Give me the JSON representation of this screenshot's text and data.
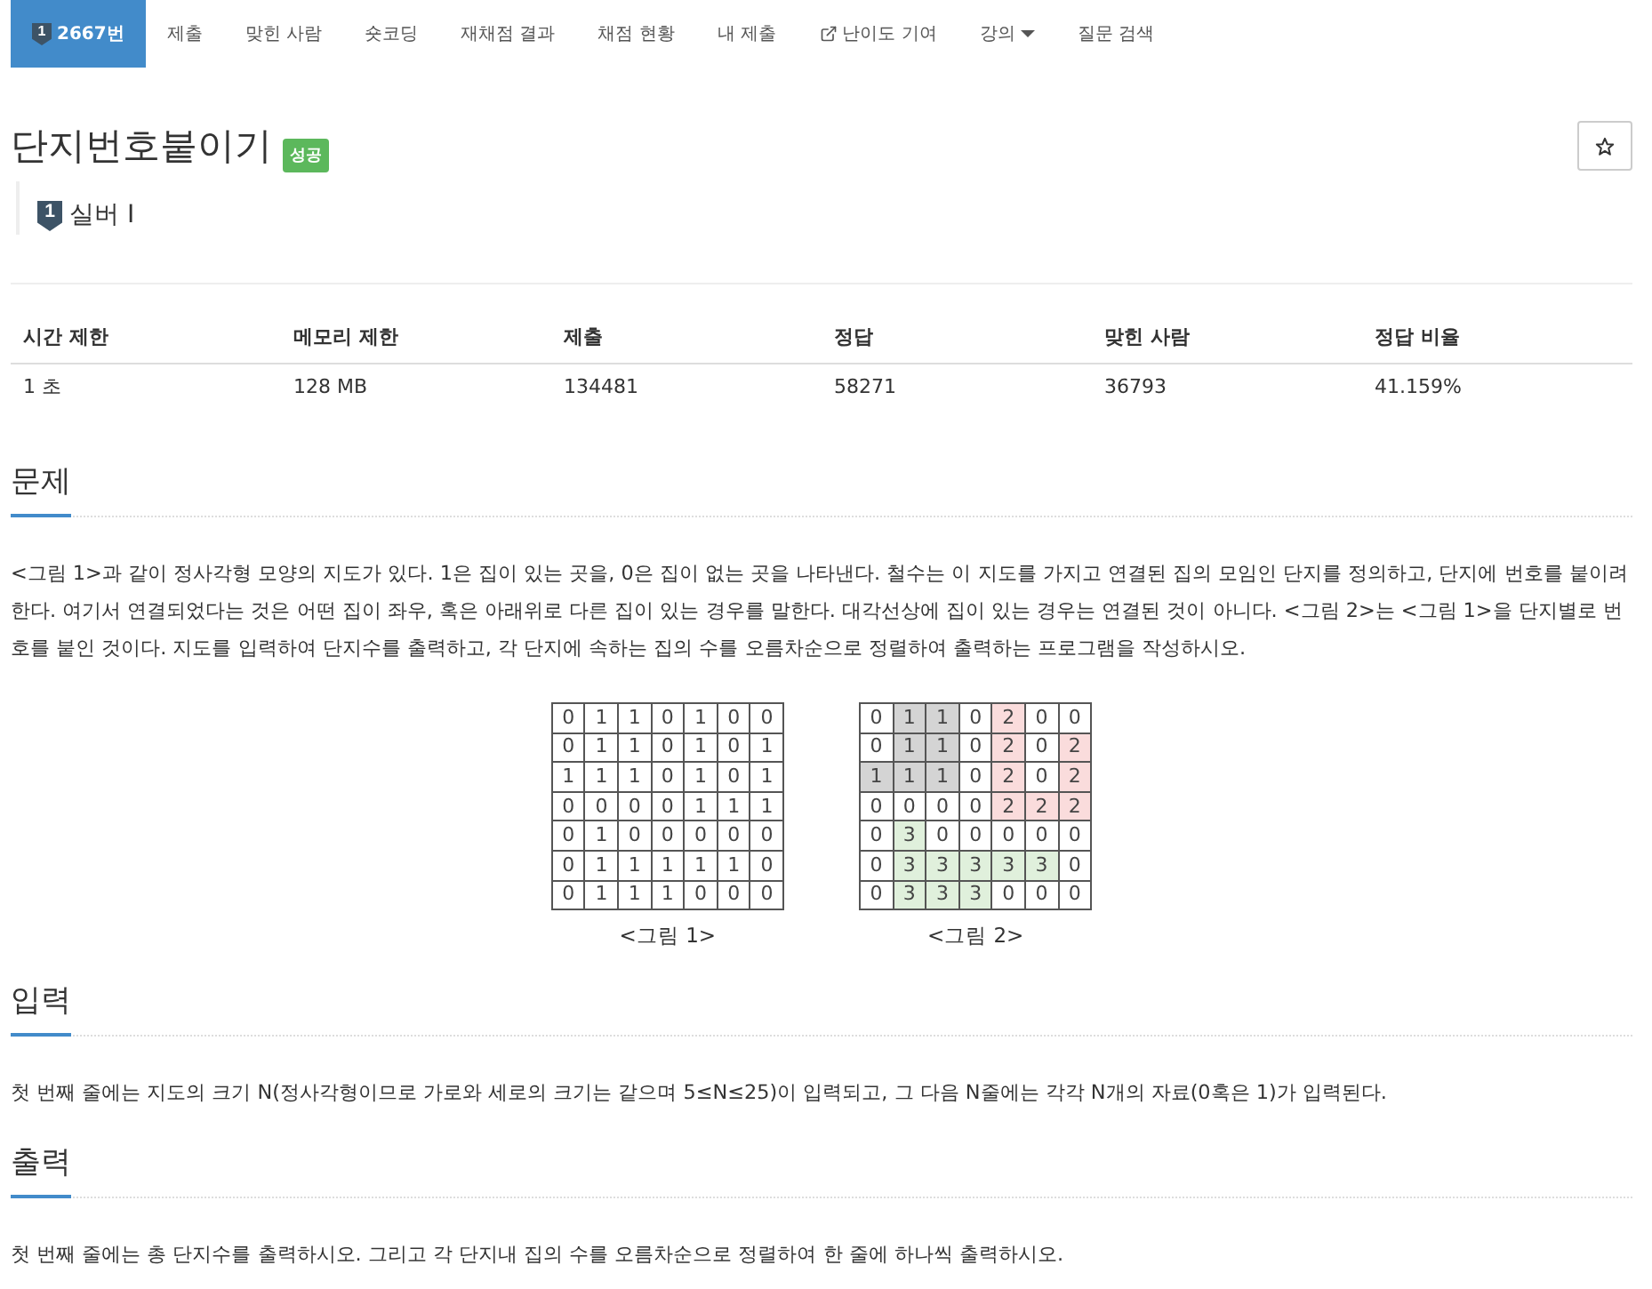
{
  "nav": {
    "tabs": [
      {
        "label": "2667번",
        "kind": "problem",
        "tier": "1",
        "selected": true
      },
      {
        "label": "제출",
        "kind": "plain",
        "selected": false
      },
      {
        "label": "맞힌 사람",
        "kind": "plain",
        "selected": false
      },
      {
        "label": "숏코딩",
        "kind": "plain",
        "selected": false
      },
      {
        "label": "재채점 결과",
        "kind": "plain",
        "selected": false
      },
      {
        "label": "채점 현황",
        "kind": "plain",
        "selected": false
      },
      {
        "label": "내 제출",
        "kind": "plain",
        "selected": false
      },
      {
        "label": "난이도 기여",
        "kind": "external",
        "selected": false
      },
      {
        "label": "강의",
        "kind": "dropdown",
        "selected": false
      },
      {
        "label": "질문 검색",
        "kind": "plain",
        "selected": false
      }
    ]
  },
  "problem": {
    "title": "단지번호붙이기",
    "badge": "성공",
    "starred": false,
    "tier": {
      "numeral": "1",
      "label": "실버 I"
    }
  },
  "stats": {
    "columns": [
      "시간 제한",
      "메모리 제한",
      "제출",
      "정답",
      "맞힌 사람",
      "정답 비율"
    ],
    "rows": [
      [
        "1 초",
        "128 MB",
        "134481",
        "58271",
        "36793",
        "41.159%"
      ]
    ]
  },
  "sections": [
    {
      "heading": "문제",
      "paragraphs": [
        "<그림 1>과 같이 정사각형 모양의 지도가 있다. 1은 집이 있는 곳을, 0은 집이 없는 곳을 나타낸다. 철수는 이 지도를 가지고 연결된 집의 모임인 단지를 정의하고, 단지에 번호를 붙이려 한다. 여기서 연결되었다는 것은 어떤 집이 좌우, 혹은 아래위로 다른 집이 있는 경우를 말한다. 대각선상에 집이 있는 경우는 연결된 것이 아니다. <그림 2>는 <그림 1>을 단지별로 번호를 붙인 것이다. 지도를 입력하여 단지수를 출력하고, 각 단지에 속하는 집의 수를 오름차순으로 정렬하여 출력하는 프로그램을 작성하시오."
      ],
      "figures": [
        {
          "caption": "<그림 1>",
          "rows": [
            [
              {
                "text": "0"
              },
              {
                "text": "1"
              },
              {
                "text": "1"
              },
              {
                "text": "0"
              },
              {
                "text": "1"
              },
              {
                "text": "0"
              },
              {
                "text": "0"
              }
            ],
            [
              {
                "text": "0"
              },
              {
                "text": "1"
              },
              {
                "text": "1"
              },
              {
                "text": "0"
              },
              {
                "text": "1"
              },
              {
                "text": "0"
              },
              {
                "text": "1"
              }
            ],
            [
              {
                "text": "1"
              },
              {
                "text": "1"
              },
              {
                "text": "1"
              },
              {
                "text": "0"
              },
              {
                "text": "1"
              },
              {
                "text": "0"
              },
              {
                "text": "1"
              }
            ],
            [
              {
                "text": "0"
              },
              {
                "text": "0"
              },
              {
                "text": "0"
              },
              {
                "text": "0"
              },
              {
                "text": "1"
              },
              {
                "text": "1"
              },
              {
                "text": "1"
              }
            ],
            [
              {
                "text": "0"
              },
              {
                "text": "1"
              },
              {
                "text": "0"
              },
              {
                "text": "0"
              },
              {
                "text": "0"
              },
              {
                "text": "0"
              },
              {
                "text": "0"
              }
            ],
            [
              {
                "text": "0"
              },
              {
                "text": "1"
              },
              {
                "text": "1"
              },
              {
                "text": "1"
              },
              {
                "text": "1"
              },
              {
                "text": "1"
              },
              {
                "text": "0"
              }
            ],
            [
              {
                "text": "0"
              },
              {
                "text": "1"
              },
              {
                "text": "1"
              },
              {
                "text": "1"
              },
              {
                "text": "0"
              },
              {
                "text": "0"
              },
              {
                "text": "0"
              }
            ]
          ]
        },
        {
          "caption": "<그림 2>",
          "rows": [
            [
              {
                "text": "0"
              },
              {
                "text": "1",
                "color": "#d4d4d4"
              },
              {
                "text": "1",
                "color": "#d4d4d4"
              },
              {
                "text": "0"
              },
              {
                "text": "2",
                "color": "#fadcdc"
              },
              {
                "text": "0"
              },
              {
                "text": "0"
              }
            ],
            [
              {
                "text": "0"
              },
              {
                "text": "1",
                "color": "#d4d4d4"
              },
              {
                "text": "1",
                "color": "#d4d4d4"
              },
              {
                "text": "0"
              },
              {
                "text": "2",
                "color": "#fadcdc"
              },
              {
                "text": "0"
              },
              {
                "text": "2",
                "color": "#fadcdc"
              }
            ],
            [
              {
                "text": "1",
                "color": "#d4d4d4"
              },
              {
                "text": "1",
                "color": "#d4d4d4"
              },
              {
                "text": "1",
                "color": "#d4d4d4"
              },
              {
                "text": "0"
              },
              {
                "text": "2",
                "color": "#fadcdc"
              },
              {
                "text": "0"
              },
              {
                "text": "2",
                "color": "#fadcdc"
              }
            ],
            [
              {
                "text": "0"
              },
              {
                "text": "0"
              },
              {
                "text": "0"
              },
              {
                "text": "0"
              },
              {
                "text": "2",
                "color": "#fadcdc"
              },
              {
                "text": "2",
                "color": "#fadcdc"
              },
              {
                "text": "2",
                "color": "#fadcdc"
              }
            ],
            [
              {
                "text": "0"
              },
              {
                "text": "3",
                "color": "#e0f0dc"
              },
              {
                "text": "0"
              },
              {
                "text": "0"
              },
              {
                "text": "0"
              },
              {
                "text": "0"
              },
              {
                "text": "0"
              }
            ],
            [
              {
                "text": "0"
              },
              {
                "text": "3",
                "color": "#e0f0dc"
              },
              {
                "text": "3",
                "color": "#e0f0dc"
              },
              {
                "text": "3",
                "color": "#e0f0dc"
              },
              {
                "text": "3",
                "color": "#e0f0dc"
              },
              {
                "text": "3",
                "color": "#e0f0dc"
              },
              {
                "text": "0"
              }
            ],
            [
              {
                "text": "0"
              },
              {
                "text": "3",
                "color": "#e0f0dc"
              },
              {
                "text": "3",
                "color": "#e0f0dc"
              },
              {
                "text": "3",
                "color": "#e0f0dc"
              },
              {
                "text": "0"
              },
              {
                "text": "0"
              },
              {
                "text": "0"
              }
            ]
          ]
        }
      ]
    },
    {
      "heading": "입력",
      "paragraphs": [
        "첫 번째 줄에는 지도의 크기 N(정사각형이므로 가로와 세로의 크기는 같으며 5≤N≤25)이 입력되고, 그 다음 N줄에는 각각 N개의 자료(0혹은 1)가 입력된다."
      ]
    },
    {
      "heading": "출력",
      "paragraphs": [
        "첫 번째 줄에는 총 단지수를 출력하시오. 그리고 각 단지내 집의 수를 오름차순으로 정렬하여 한 줄에 하나씩 출력하시오."
      ]
    }
  ]
}
